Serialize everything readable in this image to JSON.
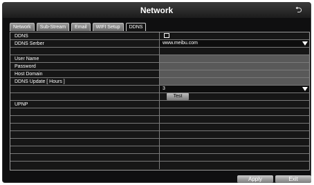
{
  "window": {
    "title": "Network"
  },
  "tabs": [
    {
      "label": "Network",
      "active": false
    },
    {
      "label": "Sub-Stream",
      "active": false
    },
    {
      "label": "Email",
      "active": false
    },
    {
      "label": "WIFI Setup",
      "active": false
    },
    {
      "label": "DDNS",
      "active": true
    }
  ],
  "form": {
    "ddns_label": "DDNS",
    "ddns_checked": false,
    "server_label": "DDNS Serber",
    "server_value": "www.meibu.com",
    "username_label": "User Name",
    "username_value": "",
    "password_label": "Password",
    "password_value": "",
    "host_label": "Host Domain",
    "host_value": "",
    "update_label": "DDNS Update [ Hours ]",
    "update_value": "3",
    "test_label": "Test",
    "upnp_label": "UPNP"
  },
  "buttons": {
    "apply": "Apply",
    "exit": "Exit"
  },
  "icons": {
    "back": "return-arrow-icon"
  }
}
